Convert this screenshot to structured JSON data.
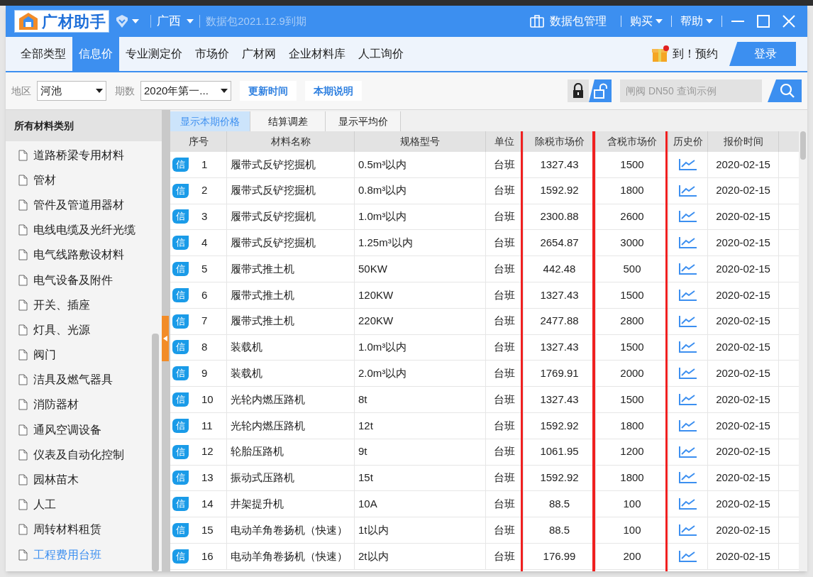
{
  "title_bar": {
    "logo_text": "广材助手",
    "region": "广西",
    "expiry": "数据包2021.12.9到期",
    "package_button": "数据包管理",
    "menus": [
      "购买",
      "帮助"
    ]
  },
  "nav_tabs": [
    {
      "label": "全部类型",
      "selected": false
    },
    {
      "label": "信息价",
      "selected": true
    },
    {
      "label": "专业测定价",
      "selected": false
    },
    {
      "label": "市场价",
      "selected": false
    },
    {
      "label": "广材网",
      "selected": false
    },
    {
      "label": "企业材料库",
      "selected": false
    },
    {
      "label": "人工询价",
      "selected": false
    }
  ],
  "promo_text": "到！预约",
  "login_button": "登录",
  "filters": {
    "region_label": "地区",
    "region_value": "河池",
    "period_label": "期数",
    "period_value": "2020年第一...",
    "buttons": [
      "更新时间",
      "本期说明"
    ],
    "search_placeholder": "闸阀 DN50 查询示例"
  },
  "sidebar": {
    "title": "所有材料类别",
    "items": [
      {
        "label": "道路桥梁专用材料",
        "selected": false
      },
      {
        "label": "管材",
        "selected": false
      },
      {
        "label": "管件及管道用器材",
        "selected": false
      },
      {
        "label": "电线电缆及光纤光缆",
        "selected": false
      },
      {
        "label": "电气线路敷设材料",
        "selected": false
      },
      {
        "label": "电气设备及附件",
        "selected": false
      },
      {
        "label": "开关、插座",
        "selected": false
      },
      {
        "label": "灯具、光源",
        "selected": false
      },
      {
        "label": "阀门",
        "selected": false
      },
      {
        "label": "洁具及燃气器具",
        "selected": false
      },
      {
        "label": "消防器材",
        "selected": false
      },
      {
        "label": "通风空调设备",
        "selected": false
      },
      {
        "label": "仪表及自动化控制",
        "selected": false
      },
      {
        "label": "园林苗木",
        "selected": false
      },
      {
        "label": "人工",
        "selected": false
      },
      {
        "label": "周转材料租赁",
        "selected": false
      },
      {
        "label": "工程费用台班",
        "selected": true
      }
    ]
  },
  "view_tabs": [
    {
      "label": "显示本期价格",
      "selected": true
    },
    {
      "label": "结算调差",
      "selected": false
    },
    {
      "label": "显示平均价",
      "selected": false
    }
  ],
  "table": {
    "columns": [
      {
        "label": "序号",
        "highlighted": false
      },
      {
        "label": "材料名称",
        "highlighted": false
      },
      {
        "label": "规格型号",
        "highlighted": false
      },
      {
        "label": "单位",
        "highlighted": false
      },
      {
        "label": "除税市场价",
        "highlighted": true
      },
      {
        "label": "含税市场价",
        "highlighted": true
      },
      {
        "label": "历史价",
        "highlighted": false
      },
      {
        "label": "报价时间",
        "highlighted": false
      }
    ],
    "rows": [
      {
        "badge": "信",
        "no": "1",
        "name": "履带式反铲挖掘机",
        "spec": "0.5m³以内",
        "unit": "台班",
        "pre_tax": "1327.43",
        "with_tax": "1500",
        "date": "2020-02-15"
      },
      {
        "badge": "信",
        "no": "2",
        "name": "履带式反铲挖掘机",
        "spec": "0.8m³以内",
        "unit": "台班",
        "pre_tax": "1592.92",
        "with_tax": "1800",
        "date": "2020-02-15"
      },
      {
        "badge": "信",
        "no": "3",
        "name": "履带式反铲挖掘机",
        "spec": "1.0m³以内",
        "unit": "台班",
        "pre_tax": "2300.88",
        "with_tax": "2600",
        "date": "2020-02-15"
      },
      {
        "badge": "信",
        "no": "4",
        "name": "履带式反铲挖掘机",
        "spec": "1.25m³以内",
        "unit": "台班",
        "pre_tax": "2654.87",
        "with_tax": "3000",
        "date": "2020-02-15"
      },
      {
        "badge": "信",
        "no": "5",
        "name": "履带式推土机",
        "spec": "50KW",
        "unit": "台班",
        "pre_tax": "442.48",
        "with_tax": "500",
        "date": "2020-02-15"
      },
      {
        "badge": "信",
        "no": "6",
        "name": "履带式推土机",
        "spec": "120KW",
        "unit": "台班",
        "pre_tax": "1327.43",
        "with_tax": "1500",
        "date": "2020-02-15"
      },
      {
        "badge": "信",
        "no": "7",
        "name": "履带式推土机",
        "spec": "220KW",
        "unit": "台班",
        "pre_tax": "2477.88",
        "with_tax": "2800",
        "date": "2020-02-15"
      },
      {
        "badge": "信",
        "no": "8",
        "name": "装载机",
        "spec": "1.0m³以内",
        "unit": "台班",
        "pre_tax": "1327.43",
        "with_tax": "1500",
        "date": "2020-02-15"
      },
      {
        "badge": "信",
        "no": "9",
        "name": "装载机",
        "spec": "2.0m³以内",
        "unit": "台班",
        "pre_tax": "1769.91",
        "with_tax": "2000",
        "date": "2020-02-15"
      },
      {
        "badge": "信",
        "no": "10",
        "name": "光轮内燃压路机",
        "spec": "8t",
        "unit": "台班",
        "pre_tax": "1327.43",
        "with_tax": "1500",
        "date": "2020-02-15"
      },
      {
        "badge": "信",
        "no": "11",
        "name": "光轮内燃压路机",
        "spec": "12t",
        "unit": "台班",
        "pre_tax": "1592.92",
        "with_tax": "1800",
        "date": "2020-02-15"
      },
      {
        "badge": "信",
        "no": "12",
        "name": "轮胎压路机",
        "spec": "9t",
        "unit": "台班",
        "pre_tax": "1061.95",
        "with_tax": "1200",
        "date": "2020-02-15"
      },
      {
        "badge": "信",
        "no": "13",
        "name": "振动式压路机",
        "spec": "15t",
        "unit": "台班",
        "pre_tax": "1592.92",
        "with_tax": "1800",
        "date": "2020-02-15"
      },
      {
        "badge": "信",
        "no": "14",
        "name": "井架提升机",
        "spec": "10A",
        "unit": "台班",
        "pre_tax": "88.5",
        "with_tax": "100",
        "date": "2020-02-15"
      },
      {
        "badge": "信",
        "no": "15",
        "name": "电动羊角卷扬机（快速）",
        "spec": "1t以内",
        "unit": "台班",
        "pre_tax": "88.5",
        "with_tax": "100",
        "date": "2020-02-15"
      },
      {
        "badge": "信",
        "no": "16",
        "name": "电动羊角卷扬机（快速）",
        "spec": "2t以内",
        "unit": "台班",
        "pre_tax": "176.99",
        "with_tax": "200",
        "date": "2020-02-15"
      }
    ]
  }
}
